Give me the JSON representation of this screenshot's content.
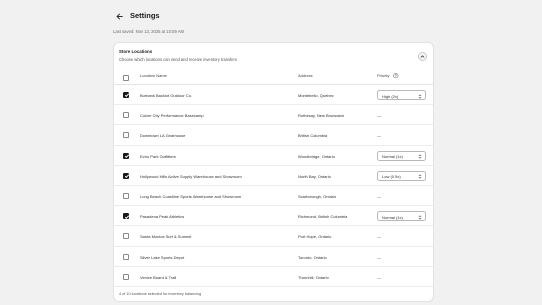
{
  "header": {
    "title": "Settings",
    "subtitle": "Last saved: Nov 13, 2025 at 10:59 AM"
  },
  "card": {
    "title": "Store Locations",
    "description": "Choose which locations can send and receive inventory transfers"
  },
  "table": {
    "columns": {
      "name": "Location Name",
      "address": "Address",
      "priority": "Priority"
    },
    "rows": [
      {
        "name": "Burbank Backlot Outdoor Co.",
        "address": "Montebello, Quebec",
        "checked": true,
        "priority": "High (2x)"
      },
      {
        "name": "Culver City Performance Basecamp",
        "address": "Rothesay, New Brunswick",
        "checked": false,
        "priority": "—"
      },
      {
        "name": "Downtown LA Gearhouse",
        "address": "British Columbia",
        "checked": false,
        "priority": "—"
      },
      {
        "name": "Echo Park Outfitters",
        "address": "Woodbridge, Ontario",
        "checked": true,
        "priority": "Normal (1x)"
      },
      {
        "name": "Hollywood Hills Active Supply Warehouse and Showroom",
        "address": "North Bay, Ontario",
        "checked": true,
        "priority": "Low (0.5x)"
      },
      {
        "name": "Long Beach Coastline Sports Warehouse and Showroom",
        "address": "Scarborough, Ontario",
        "checked": false,
        "priority": "—"
      },
      {
        "name": "Pasadena Peak Athletics",
        "address": "Richmond, British Columbia",
        "checked": true,
        "priority": "Normal (1x)"
      },
      {
        "name": "Santa Monica Surf & Summit",
        "address": "Port Hope, Ontario",
        "checked": false,
        "priority": "—"
      },
      {
        "name": "Silver Lake Sports Depot",
        "address": "Toronto, Ontario",
        "checked": false,
        "priority": "—"
      },
      {
        "name": "Venice Board & Trail",
        "address": "Thornhill, Ontario",
        "checked": false,
        "priority": "—"
      }
    ]
  },
  "footer": {
    "summary": "4 of 10 locations selected for inventory balancing"
  },
  "icons": {
    "back": "arrow-left-icon",
    "collapse": "chevron-up-icon",
    "help": "question-circle-icon",
    "select": "select-arrows-icon"
  },
  "colors": {
    "background": "#f1f1f1",
    "card": "#ffffff",
    "checkbox_checked": "#1a1a1a"
  }
}
